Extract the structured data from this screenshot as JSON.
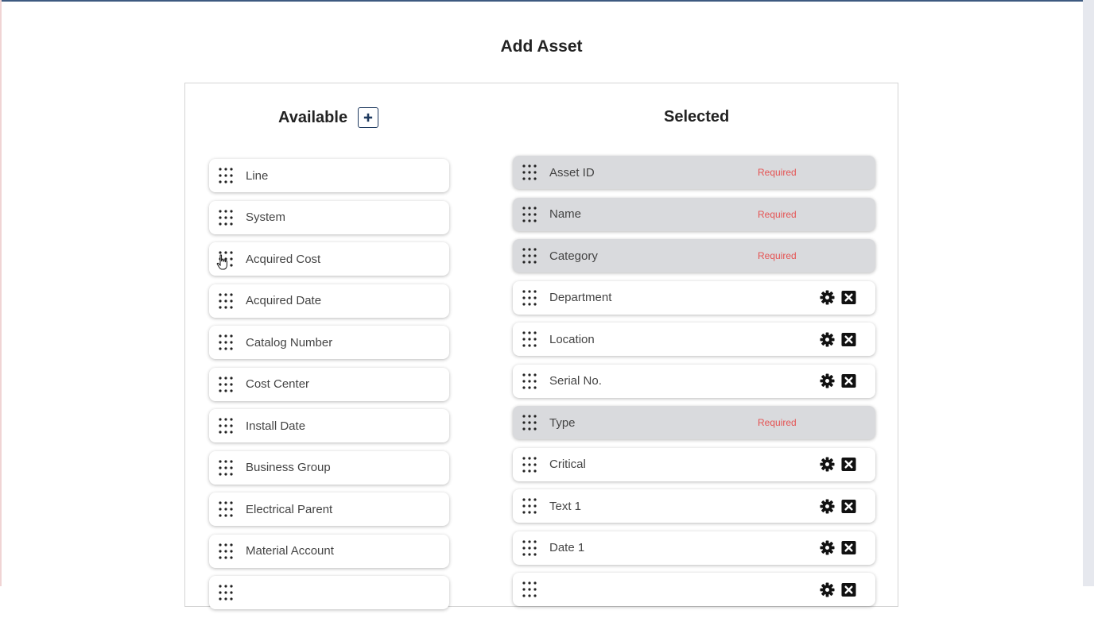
{
  "page": {
    "title": "Add Asset"
  },
  "available": {
    "heading": "Available",
    "items": [
      "Line",
      "System",
      "Acquired Cost",
      "Acquired Date",
      "Catalog Number",
      "Cost Center",
      "Install Date",
      "Business Group",
      "Electrical Parent",
      "Material Account",
      ""
    ]
  },
  "selected": {
    "heading": "Selected",
    "required_label": "Required",
    "items": [
      {
        "label": "Asset ID",
        "required": true
      },
      {
        "label": "Name",
        "required": true
      },
      {
        "label": "Category",
        "required": true
      },
      {
        "label": "Department",
        "required": false
      },
      {
        "label": "Location",
        "required": false
      },
      {
        "label": "Serial No.",
        "required": false
      },
      {
        "label": "Type",
        "required": true
      },
      {
        "label": "Critical",
        "required": false
      },
      {
        "label": "Text 1",
        "required": false
      },
      {
        "label": "Date 1",
        "required": false
      },
      {
        "label": "",
        "required": false
      }
    ]
  },
  "icons": {
    "drag": "drag-handle-icon",
    "add": "plus-icon",
    "settings": "gear-icon",
    "remove": "close-box-icon",
    "cursor": "hand-pointer-icon"
  },
  "colors": {
    "accent": "#1f3a5f",
    "required_text": "#e55353",
    "required_bg": "#d9dadd"
  }
}
